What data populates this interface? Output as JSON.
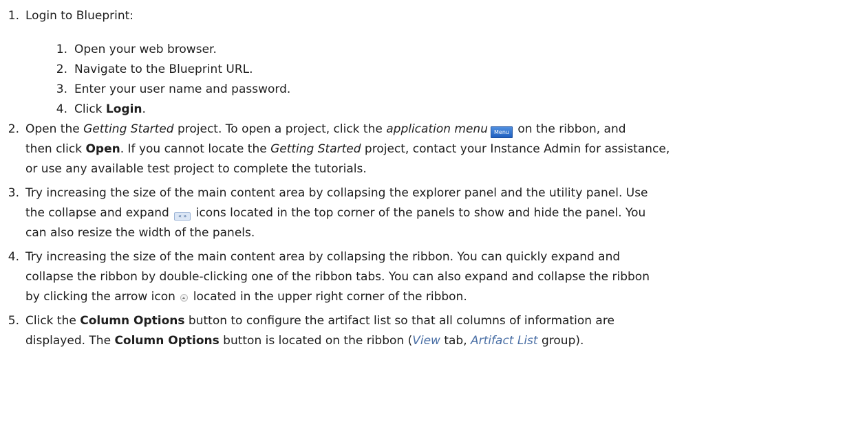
{
  "steps": [
    {
      "number": "1.",
      "text": "Login to Blueprint:",
      "substeps": [
        {
          "number": "1.",
          "text": "Open your web browser."
        },
        {
          "number": "2.",
          "text": "Navigate to the Blueprint URL."
        },
        {
          "number": "3.",
          "text": "Enter your user name and password."
        },
        {
          "number": "4.",
          "prefix": "Click ",
          "bold": "Login",
          "suffix": "."
        }
      ]
    },
    {
      "number": "2.",
      "l1_a": "Open the ",
      "l1_b": "Getting Started",
      "l1_c": " project. To open a project, click the ",
      "l1_d": "application menu",
      "l1_e": "on the ribbon, and",
      "menu_icon_label": "Menu",
      "menu_icon": "menu-icon",
      "l2_a": "then click ",
      "l2_b": "Open",
      "l2_c": ". If you cannot locate the ",
      "l2_d": "Getting Started",
      "l2_e": " project, contact your Instance Admin for assistance,",
      "l3": "or use any available test project to complete the tutorials."
    },
    {
      "number": "3.",
      "l1": "Try increasing the size of the main content area by collapsing the explorer panel and the utility panel. Use",
      "l2_a": "the collapse and expand",
      "collapse_icon_label": "« »",
      "collapse_icon": "collapse-expand-icon",
      "l2_b": "icons located in the top corner of the panels to show and hide the panel. You",
      "l3": "can also resize the width of the panels."
    },
    {
      "number": "4.",
      "l1": "Try increasing the size of the main content area by collapsing the ribbon. You can quickly expand and",
      "l2": "collapse the ribbon by double-clicking one of the ribbon tabs. You can also expand and collapse the ribbon",
      "l3_a": "by clicking the arrow icon",
      "arrow_icon": "arrow-up-icon",
      "l3_b": "located in the upper right corner of the ribbon."
    },
    {
      "number": "5.",
      "l1_a": "Click the ",
      "l1_b": "Column Options",
      "l1_c": " button to configure the artifact list so that all columns of information are",
      "l2_a": "displayed. The ",
      "l2_b": "Column Options",
      "l2_c": " button is located on the ribbon (",
      "l2_d": "View",
      "l2_e": " tab, ",
      "l2_f": "Artifact List",
      "l2_g": " group)."
    }
  ]
}
